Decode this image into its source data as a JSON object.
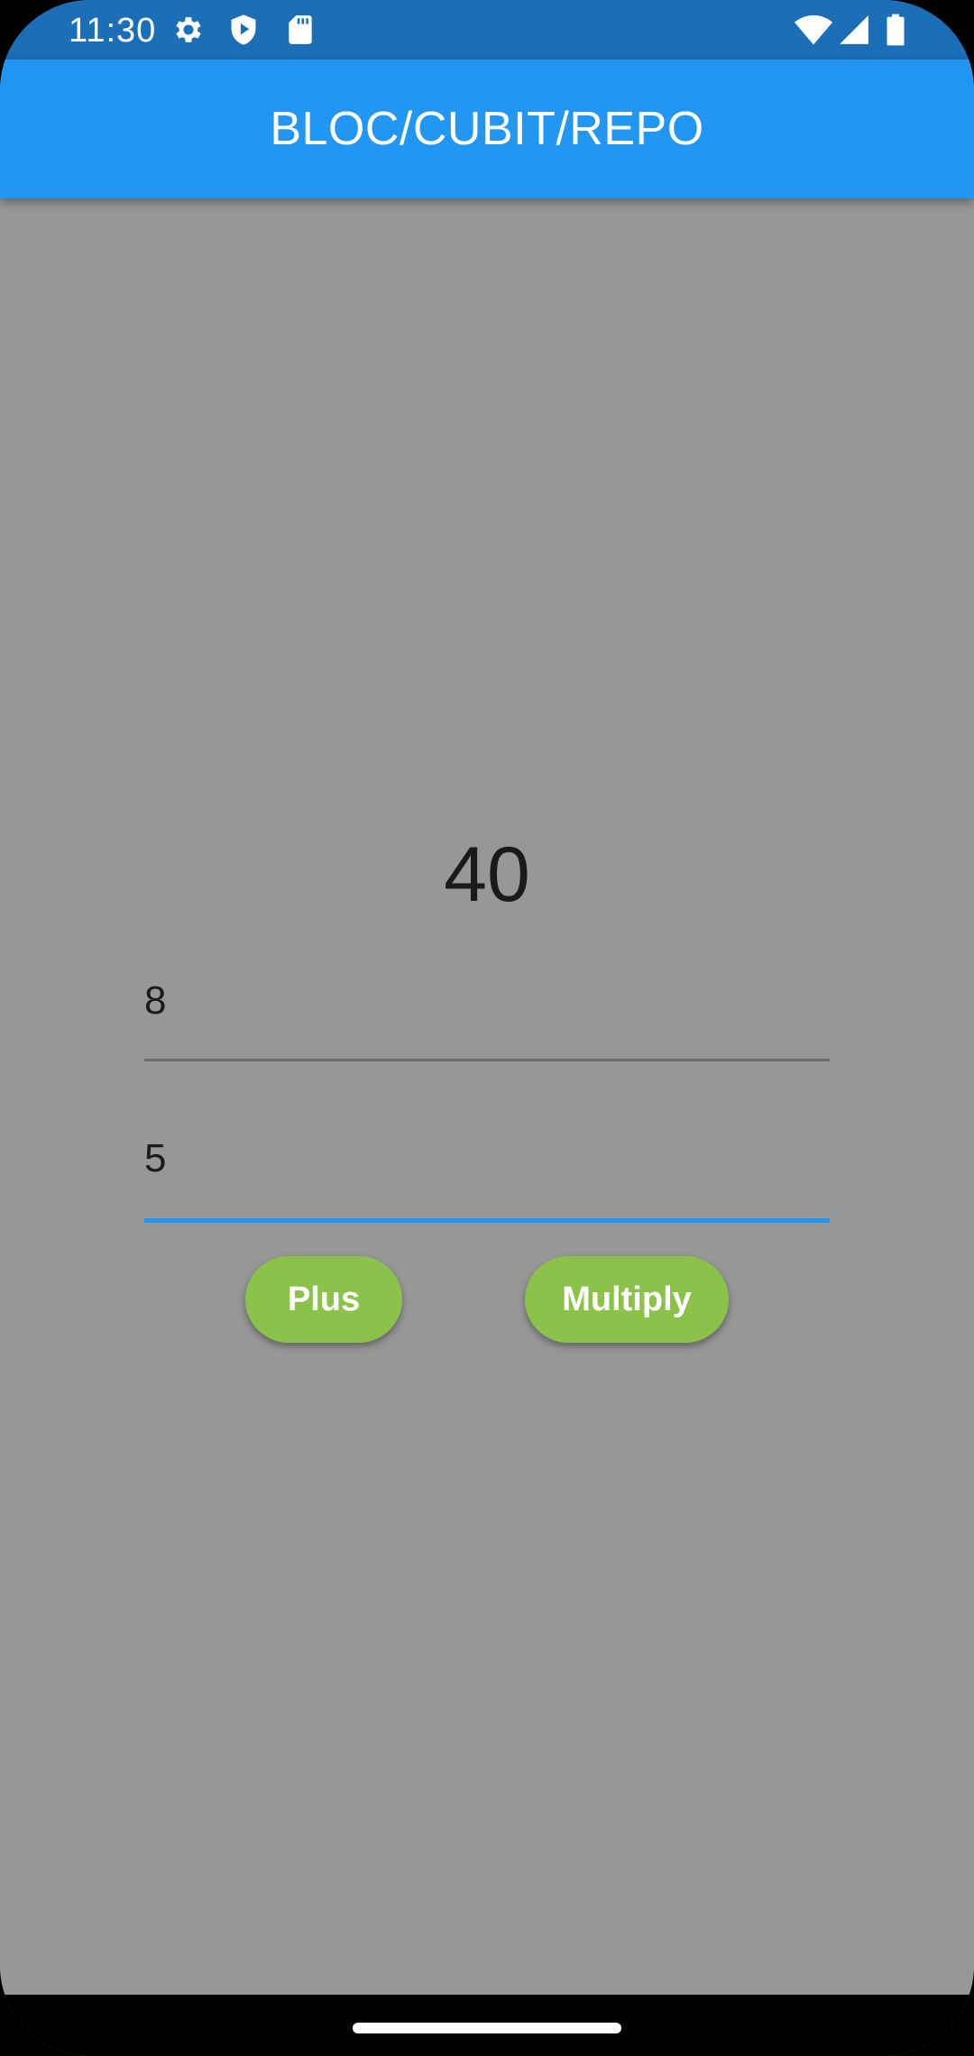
{
  "status_bar": {
    "time": "11:30",
    "left_icons": [
      "gear-icon",
      "shield-play-icon",
      "sd-card-icon"
    ],
    "right_icons": [
      "wifi-icon",
      "cell-signal-icon",
      "battery-icon"
    ],
    "background": "#1b6fb8"
  },
  "app_bar": {
    "title": "BLOC/CUBIT/REPO",
    "background": "#2196f3"
  },
  "main": {
    "result": "40",
    "first_input": {
      "value": "8",
      "placeholder": ""
    },
    "second_input": {
      "value": "5",
      "placeholder": ""
    },
    "plus_label": "Plus",
    "multiply_label": "Multiply",
    "button_color": "#8bc34a",
    "background": "#979797",
    "focus_color": "#2196f3"
  }
}
